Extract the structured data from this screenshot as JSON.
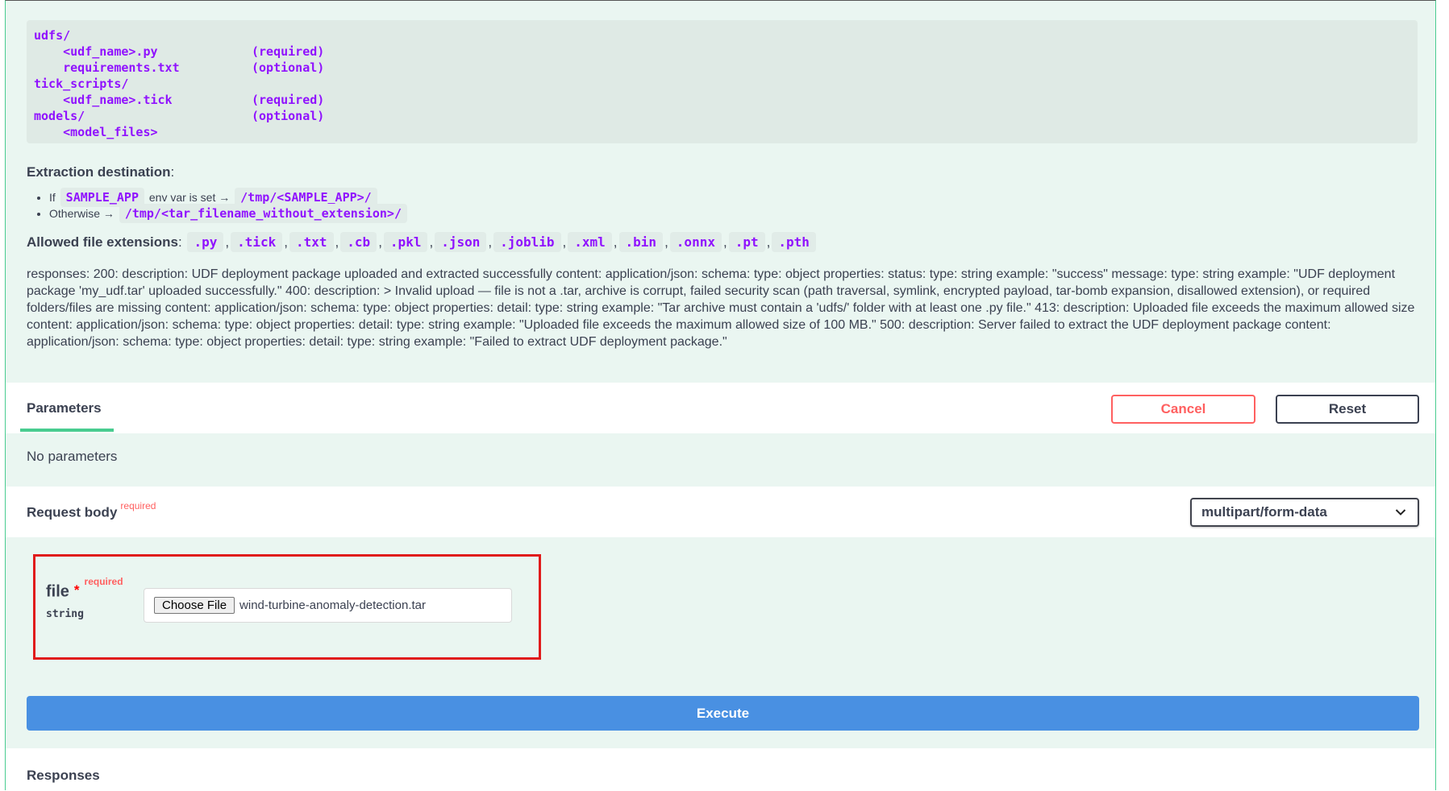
{
  "code_block": {
    "lines": [
      {
        "path": "udfs/",
        "note": ""
      },
      {
        "path": "    <udf_name>.py",
        "note": "(required)"
      },
      {
        "path": "    requirements.txt",
        "note": "(optional)"
      },
      {
        "path": "tick_scripts/",
        "note": ""
      },
      {
        "path": "    <udf_name>.tick",
        "note": "(required)"
      },
      {
        "path": "models/",
        "note": "(optional)"
      },
      {
        "path": "    <model_files>",
        "note": ""
      }
    ]
  },
  "extraction": {
    "label": "Extraction destination",
    "colon": ":",
    "item1_prefix": "If",
    "item1_var": "SAMPLE_APP",
    "item1_middle": "env var is set →",
    "item1_path": "/tmp/<SAMPLE_APP>/",
    "item2_prefix": "Otherwise →",
    "item2_path": "/tmp/<tar_filename_without_extension>/"
  },
  "extensions": {
    "label": "Allowed file extensions",
    "colon": ":",
    "items": [
      ".py",
      ".tick",
      ".txt",
      ".cb",
      ".pkl",
      ".json",
      ".joblib",
      ".xml",
      ".bin",
      ".onnx",
      ".pt",
      ".pth"
    ]
  },
  "responses_description": "responses: 200: description: UDF deployment package uploaded and extracted successfully content: application/json: schema: type: object properties: status: type: string example: \"success\" message: type: string example: \"UDF deployment package 'my_udf.tar' uploaded successfully.\" 400: description: > Invalid upload — file is not a .tar, archive is corrupt, failed security scan (path traversal, symlink, encrypted payload, tar-bomb expansion, disallowed extension), or required folders/files are missing content: application/json: schema: type: object properties: detail: type: string example: \"Tar archive must contain a 'udfs/' folder with at least one .py file.\" 413: description: Uploaded file exceeds the maximum allowed size content: application/json: schema: type: object properties: detail: type: string example: \"Uploaded file exceeds the maximum allowed size of 100 MB.\" 500: description: Server failed to extract the UDF deployment package content: application/json: schema: type: object properties: detail: type: string example: \"Failed to extract UDF deployment package.\"",
  "parameters": {
    "tab_label": "Parameters",
    "cancel_label": "Cancel",
    "reset_label": "Reset",
    "empty_text": "No parameters"
  },
  "request_body": {
    "label": "Request body",
    "required_label": "required",
    "content_type": "multipart/form-data"
  },
  "file_param": {
    "name": "file",
    "star": "*",
    "required_label": "required",
    "type": "string",
    "choose_label": "Choose File",
    "filename": "wind-turbine-anomaly-detection.tar"
  },
  "execute_label": "Execute",
  "responses_heading": "Responses",
  "colors": {
    "accent_green": "#49cc90",
    "code_purple": "#9012fe",
    "cancel_red": "#ff6060",
    "execute_blue": "#4990e2",
    "highlight_red": "#e01b1b"
  }
}
